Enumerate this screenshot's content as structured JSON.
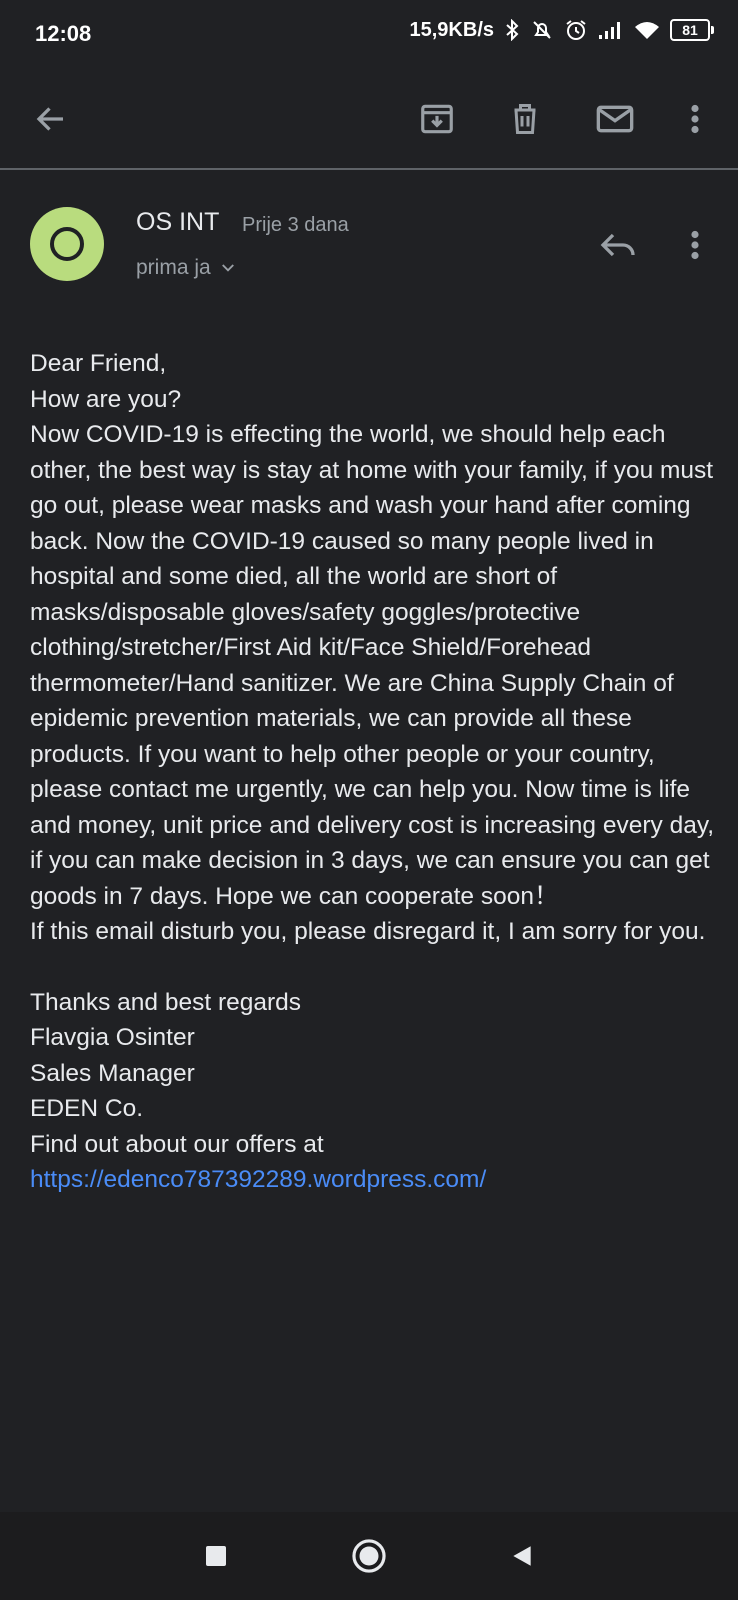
{
  "status_bar": {
    "time": "12:08",
    "net_speed": "15,9KB/s",
    "battery": "81",
    "icons": [
      "bluetooth-icon",
      "alarm-off-icon",
      "alarm-icon",
      "signal-icon",
      "wifi-icon",
      "battery-icon"
    ]
  },
  "toolbar": {
    "icons": [
      "back-arrow-icon",
      "archive-icon",
      "delete-icon",
      "mail-icon",
      "more-vert-icon"
    ]
  },
  "email": {
    "sender_name": "OS INT",
    "time": "Prije 3 dana",
    "recipient": "prima ja",
    "avatar_letter": "O",
    "avatar_color": "#b9dc7e",
    "body": {
      "l1": "Dear Friend,",
      "l2": "How are you?",
      "l3": "Now COVID-19 is effecting the world, we should help each other, the best way is stay at home with your family, if you must go out, please wear masks and wash your hand after coming back.  Now the COVID-19 caused so many people lived in hospital and some died, all the world are short of masks/disposable gloves/safety goggles/protective clothing/stretcher/First Aid kit/Face Shield/Forehead thermometer/Hand sanitizer. We are China Supply Chain of epidemic prevention materials, we can provide all these products. If you want to help other people or your country, please contact me urgently, we can help you. Now time is life and money, unit price and delivery cost is increasing every day, if you can make decision in 3 days, we can ensure you can get goods in 7 days. Hope we can cooperate soon！",
      "l4": "If this email disturb you, please disregard it, I am sorry for you.",
      "sig1": "Thanks and best regards",
      "sig2": "Flavgia Osinter",
      "sig3": "Sales Manager",
      "sig4": "EDEN Co.",
      "sig5": "Find out about our offers at",
      "link": "https://edenco787392289.wordpress.com/"
    },
    "link_color": "#4a8cf7"
  },
  "nav_bar": {
    "icons": [
      "recents-icon",
      "home-icon",
      "back-triangle-icon"
    ]
  }
}
